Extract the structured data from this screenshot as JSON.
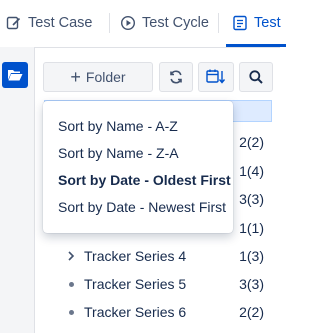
{
  "tabs": [
    {
      "label": "Test Case",
      "icon": "edit-icon"
    },
    {
      "label": "Test Cycle",
      "icon": "cycle-icon"
    },
    {
      "label": "Test",
      "icon": "list-doc-icon"
    }
  ],
  "toolbar": {
    "folder_label": "Folder",
    "plus_glyph": "+"
  },
  "tree": [
    {
      "name": "",
      "count": "2(2)"
    },
    {
      "name": "",
      "count": "1(4)"
    },
    {
      "name": "",
      "count": "3(3)"
    },
    {
      "name": "",
      "count": "1(1)"
    },
    {
      "name": "Tracker Series 4",
      "count": "1(3)",
      "lead": "chevron"
    },
    {
      "name": "Tracker Series 5",
      "count": "3(3)",
      "lead": "dot"
    },
    {
      "name": "Tracker Series 6",
      "count": "2(2)",
      "lead": "dot"
    }
  ],
  "sort_menu": {
    "items": [
      {
        "label": "Sort by Name - A-Z",
        "selected": false
      },
      {
        "label": "Sort by Name - Z-A",
        "selected": false
      },
      {
        "label": "Sort by Date - Oldest First",
        "selected": true
      },
      {
        "label": "Sort by Date - Newest First",
        "selected": false
      }
    ]
  },
  "colors": {
    "accent": "#0052cc",
    "selection": "#deebff"
  }
}
